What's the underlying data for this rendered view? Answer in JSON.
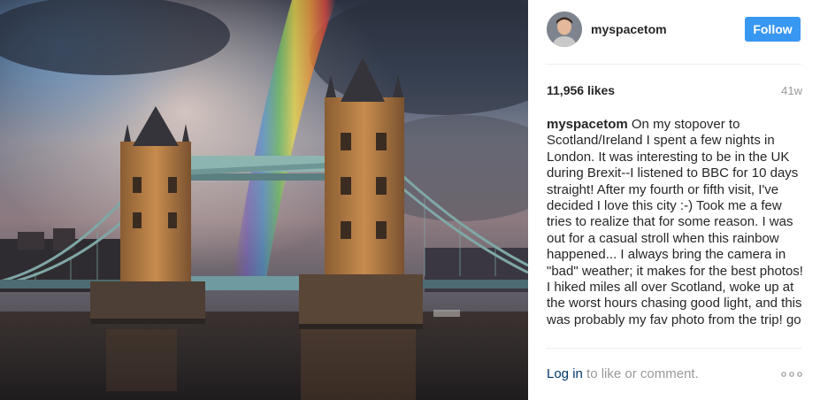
{
  "post": {
    "username": "myspacetom",
    "follow_label": "Follow",
    "likes": "11,956 likes",
    "age": "41w",
    "caption_user": "myspacetom",
    "caption_text": "On my stopover to Scotland/Ireland I spent a few nights in London. It was interesting to be in the UK during Brexit--I listened to BBC for 10 days straight! After my fourth or fifth visit, I've decided I love this city :-) Took me a few tries to realize that for some reason. I was out for a casual stroll when this rainbow happened... I always bring the camera in \"bad\" weather; it makes for the best photos! I hiked miles all over Scotland, woke up at the worst hours chasing good light, and this was probably my fav photo from the trip! go",
    "login_label": "Log in",
    "comment_prompt": " to like or comment."
  },
  "colors": {
    "follow_button": "#3897f0",
    "login_link": "#003569",
    "muted_text": "#999999"
  },
  "icons": {
    "more": "more-options-icon",
    "avatar": "avatar"
  }
}
